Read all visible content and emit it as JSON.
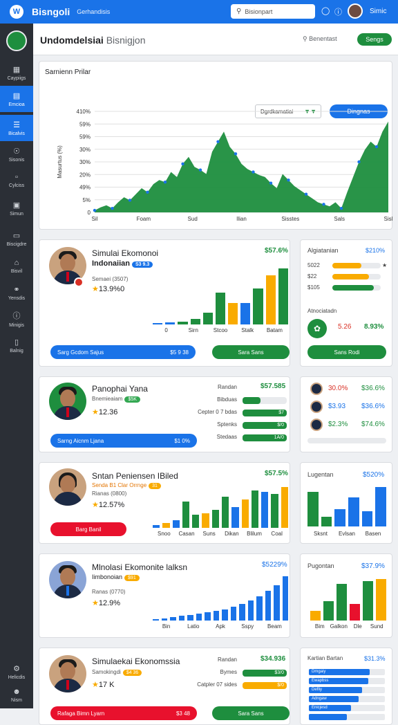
{
  "topbar": {
    "logo": "W",
    "brand": "Bisngoli",
    "sub": "Gerhandisis",
    "search_placeholder": "Bisionpart",
    "user": "Simic"
  },
  "sidebar": {
    "items": [
      {
        "icon": "grid-icon",
        "label": "Caypiigs"
      },
      {
        "icon": "chart-icon",
        "label": "Emcioa"
      },
      {
        "icon": "list-icon",
        "label": "Bicalvis"
      },
      {
        "icon": "target-icon",
        "label": "Sisonis"
      },
      {
        "icon": "doc-icon",
        "label": "Cylciss"
      },
      {
        "icon": "calc-icon",
        "label": "Simun"
      },
      {
        "icon": "book-icon",
        "label": "Biscigdre"
      },
      {
        "icon": "home-icon",
        "label": "Bisvil"
      },
      {
        "icon": "globe-icon",
        "label": "Yensdis"
      },
      {
        "icon": "help-icon",
        "label": "Minigis"
      },
      {
        "icon": "chat-icon",
        "label": "Balnig"
      }
    ],
    "bottom": [
      {
        "icon": "settings-icon",
        "label": "Helicdis"
      },
      {
        "icon": "people-icon",
        "label": "Nism"
      }
    ]
  },
  "header": {
    "title": "Undomdelsiai",
    "title_rest": "Bisnigjon",
    "search": "Benentast",
    "action": "Sengs"
  },
  "main_chart_card": {
    "title": "Sarnienn Prilar",
    "select": "Dgrdkamatiai",
    "button": "Dingnas",
    "ylabel": "Masurtus (%)"
  },
  "chart_data": {
    "type": "area",
    "title": "Sarnienn Prilar",
    "ylabel": "Masurtus (%)",
    "y_ticks": [
      "0",
      "5%",
      "49%",
      "20%",
      "30%",
      "30%",
      "59%",
      "59%",
      "410%"
    ],
    "x_ticks": [
      "Sil",
      "Foam",
      "Sud",
      "Ilian",
      "Sisstes",
      "Sals",
      "Sisl"
    ],
    "values": [
      2,
      5,
      7,
      4,
      10,
      15,
      12,
      18,
      24,
      20,
      28,
      32,
      30,
      40,
      35,
      48,
      55,
      45,
      42,
      38,
      60,
      70,
      80,
      65,
      58,
      48,
      43,
      40,
      37,
      35,
      29,
      24,
      38,
      32,
      26,
      22,
      18,
      14,
      10,
      8,
      6,
      10,
      4,
      20,
      35,
      50,
      62,
      70,
      65,
      80,
      90
    ],
    "series_color": "#1e8e3e",
    "ylim": [
      0,
      100
    ]
  },
  "profiles": [
    {
      "title": "Simulai Ekomonoi",
      "subtitle": "Indonaiian",
      "pill": "S3 9.3",
      "pill_color": "#1a73e8",
      "meta": "Semaei (3507)",
      "value": "13.9%0",
      "price": "$57.6%",
      "btn1": "Sarg Gcdom Sajus",
      "btn1_val": "$5 9 38",
      "btn2": "Sara Sans"
    },
    {
      "title": "Panophai Yana",
      "subtitle": "Bnemieaiam",
      "pill": "$5K",
      "pill_color": "#34a853",
      "meta": "",
      "value": "12.36",
      "price": "$57.585",
      "btn1": "Sarng Aicnm Ljana",
      "btn1_val": "$1 0%"
    },
    {
      "title": "Sntan Peniensen IBiled",
      "subtitle": "Senda B1 Clar Orrnge",
      "pill": "31",
      "pill_color": "#f9ab00",
      "meta": "Rianas (0800)",
      "value": "12.57%",
      "price": "$57.5%",
      "btn1": "Barg Banil"
    },
    {
      "title": "Mlnolasi Ekomonite lalksn",
      "subtitle": "Iimbonoian",
      "pill": "$91",
      "pill_color": "#f9ab00",
      "meta": "Ranas (0770)",
      "value": "12.9%",
      "price": "$5229%"
    },
    {
      "title": "Simulaekai Ekonomssia",
      "subtitle": "Samokingdi",
      "pill": "$4 36",
      "pill_color": "#f9ab00",
      "meta": "",
      "value": "17 K",
      "btn1": "Rafaga Bimn Lyarn",
      "btn1_val": "$3 48",
      "btn2": "Sara Sans"
    }
  ],
  "card1": {
    "xlabels": [
      "0",
      "Sirn",
      "Stcoo",
      "Stalk",
      "Batam"
    ],
    "bars": [
      {
        "c": "#1a73e8",
        "v": 2
      },
      {
        "c": "#1a73e8",
        "v": 3
      },
      {
        "c": "#1e8e3e",
        "v": 4
      },
      {
        "c": "#1e8e3e",
        "v": 8
      },
      {
        "c": "#1e8e3e",
        "v": 18
      },
      {
        "c": "#1e8e3e",
        "v": 48
      },
      {
        "c": "#f9ab00",
        "v": 32
      },
      {
        "c": "#1a73e8",
        "v": 32
      },
      {
        "c": "#1e8e3e",
        "v": 54
      },
      {
        "c": "#f9ab00",
        "v": 74
      },
      {
        "c": "#1e8e3e",
        "v": 85
      }
    ]
  },
  "side1": {
    "title": "Algiatanian",
    "price": "$210%",
    "rows": [
      {
        "label": "5022",
        "fill": 0.6,
        "c": "#f9ab00",
        "tail": "★"
      },
      {
        "label": "$22",
        "fill": 0.75,
        "c": "#f9ab00"
      },
      {
        "label": "$105",
        "fill": 0.85,
        "c": "#1e8e3e"
      }
    ],
    "sub": "Atnociatadn",
    "v1": "5.26",
    "v2": "8.93%",
    "btn": "Sans Rodi"
  },
  "card2": {
    "rows": [
      {
        "label": "Randan",
        "val": "$57.585",
        "fill": 0
      },
      {
        "label": "Bibduas",
        "val": "",
        "fill": 0.4
      },
      {
        "label": "Cepter 0 7 bdas",
        "val": "$7",
        "fill": 1
      },
      {
        "label": "Sptenks",
        "val": "$/0",
        "fill": 1
      },
      {
        "label": "Stedaas",
        "val": "1A/0",
        "fill": 1
      }
    ]
  },
  "side2": {
    "rows": [
      {
        "l": "30.0%",
        "r": "$36.6%",
        "lc": "#d93025",
        "rc": "#1e8e3e"
      },
      {
        "l": "$3.93",
        "r": "$36.6%",
        "lc": "#1a73e8",
        "rc": "#1a73e8"
      },
      {
        "l": "$2.3%",
        "r": "$74.6%",
        "lc": "#1e8e3e",
        "rc": "#1e8e3e"
      }
    ]
  },
  "card3": {
    "xlabels": [
      "Snoo",
      "Casan",
      "Suns",
      "Dikan",
      "Blilum",
      "Coal"
    ],
    "bars": [
      {
        "c": "#1a73e8",
        "v": 4
      },
      {
        "c": "#f9ab00",
        "v": 8
      },
      {
        "c": "#1a73e8",
        "v": 12
      },
      {
        "c": "#1e8e3e",
        "v": 40
      },
      {
        "c": "#1e8e3e",
        "v": 20
      },
      {
        "c": "#f9ab00",
        "v": 22
      },
      {
        "c": "#1e8e3e",
        "v": 28
      },
      {
        "c": "#1e8e3e",
        "v": 48
      },
      {
        "c": "#1a73e8",
        "v": 32
      },
      {
        "c": "#f9ab00",
        "v": 44
      },
      {
        "c": "#1e8e3e",
        "v": 58
      },
      {
        "c": "#1a73e8",
        "v": 55
      },
      {
        "c": "#1e8e3e",
        "v": 52
      },
      {
        "c": "#f9ab00",
        "v": 63
      }
    ]
  },
  "side3": {
    "title": "Lugentan",
    "price": "$520%",
    "xlabels": [
      "Sksnt",
      "Evlsan",
      "Basen"
    ],
    "bars": [
      {
        "c": "#1e8e3e",
        "v": 80
      },
      {
        "c": "#1e8e3e",
        "v": 22
      },
      {
        "c": "#1a73e8",
        "v": 40
      },
      {
        "c": "#1a73e8",
        "v": 68
      },
      {
        "c": "#1a73e8",
        "v": 35
      },
      {
        "c": "#1a73e8",
        "v": 92
      }
    ]
  },
  "card4": {
    "xlabels": [
      "Bin",
      "Latio",
      "Apk",
      "Sspy",
      "Beam"
    ],
    "bars": [
      2,
      4,
      6,
      8,
      10,
      12,
      14,
      17,
      20,
      24,
      29,
      35,
      42,
      52,
      62,
      78
    ]
  },
  "side4": {
    "title": "Pugontan",
    "price": "$37.9%",
    "xlabels": [
      "Bim",
      "Galkon",
      "Dle",
      "Sund"
    ],
    "bars": [
      {
        "c": "#f9ab00",
        "v": 18
      },
      {
        "c": "#1e8e3e",
        "v": 36
      },
      {
        "c": "#1e8e3e",
        "v": 68
      },
      {
        "c": "#e8112d",
        "v": 30
      },
      {
        "c": "#1e8e3e",
        "v": 72
      },
      {
        "c": "#f9ab00",
        "v": 76
      }
    ]
  },
  "card5": {
    "rows": [
      {
        "label": "Randan",
        "val": "$34.936",
        "fill": 0
      },
      {
        "label": "Bymes",
        "val": "$3/0",
        "fill": 1,
        "c": "#1e8e3e"
      },
      {
        "label": "Catpler 07 sides",
        "val": "$/0",
        "fill": 1,
        "c": "#f9ab00"
      }
    ]
  },
  "side5": {
    "title": "Kartian Bartan",
    "price": "$31.3%",
    "rows": [
      {
        "l": "Dmgaiy",
        "f": 0.8
      },
      {
        "l": "Ewapbss",
        "f": 0.78
      },
      {
        "l": "Defliy",
        "f": 0.7
      },
      {
        "l": "Adngaw",
        "f": 0.65
      },
      {
        "l": "Enicjesd",
        "f": 0.55
      },
      {
        "l": "",
        "f": 0.5
      }
    ]
  }
}
